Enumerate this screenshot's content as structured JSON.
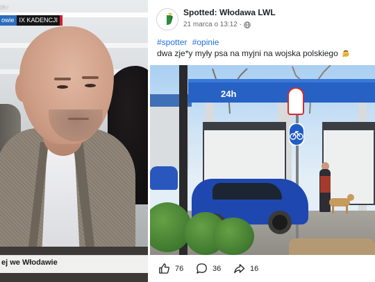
{
  "left_video": {
    "date_fragment": "26 r",
    "tag_left": "owie",
    "tag_right": "IX KADENCJI",
    "caption": "ej we Włodawie"
  },
  "post": {
    "page_name": "Spotted: Włodawa LWL",
    "date": "21 marca o 13:12",
    "hashtags": [
      "#spotter",
      "#opinie"
    ],
    "text": "dwa zje*y myły psa na myjni na wojska polskiego",
    "photo": {
      "canopy_label": "24h"
    },
    "reactions": {
      "likes": "76",
      "comments": "36",
      "shares": "16"
    },
    "icons": [
      "globe-icon",
      "like-icon",
      "comment-icon",
      "share-icon",
      "facepalm-emoji"
    ],
    "colors": {
      "hashtag": "#216fdb",
      "meta": "#65676b",
      "text": "#1c1e21"
    }
  }
}
